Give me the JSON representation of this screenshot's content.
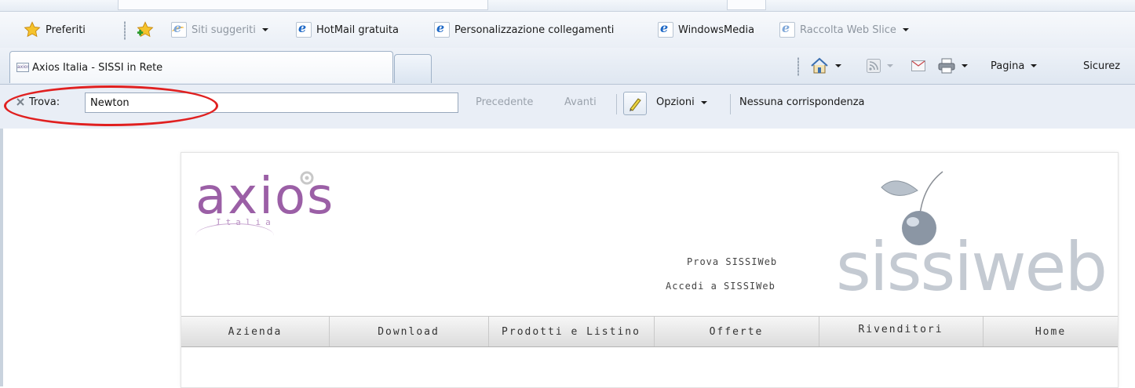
{
  "colors": {
    "highlight_ring": "#e02020",
    "logo_axios": "#9b5fa6",
    "logo_sissiweb": "#c4cad2"
  },
  "favorites_bar": {
    "favorites_label": "Preferiti",
    "links": [
      {
        "label": "Siti suggeriti",
        "icon": "ie-icon",
        "has_dropdown": true,
        "disabled": true
      },
      {
        "label": "HotMail gratuita",
        "icon": "ie-icon"
      },
      {
        "label": "Personalizzazione collegamenti",
        "icon": "ie-icon"
      },
      {
        "label": "WindowsMedia",
        "icon": "ie-icon"
      },
      {
        "label": "Raccolta Web Slice",
        "icon": "ie-icon",
        "has_dropdown": true,
        "disabled": true
      }
    ]
  },
  "tabs": {
    "active_tab_title": "Axios Italia - SISSI in Rete",
    "favicon_text": "axios"
  },
  "command_bar": {
    "page_label": "Pagina",
    "security_label": "Sicurez"
  },
  "find_bar": {
    "label": "Trova:",
    "value": "Newton",
    "previous": "Precedente",
    "next": "Avanti",
    "options": "Opzioni",
    "status": "Nessuna corrispondenza"
  },
  "site": {
    "logo_left_text": "axios",
    "logo_left_sub": "Italia",
    "logo_right_text": "sissiweb",
    "links": [
      "Prova SISSIWeb",
      "Accedi a SISSIWeb"
    ],
    "nav": [
      "Azienda",
      "Download",
      "Prodotti e Listino",
      "Offerte",
      "Rivenditori",
      "Home"
    ]
  }
}
